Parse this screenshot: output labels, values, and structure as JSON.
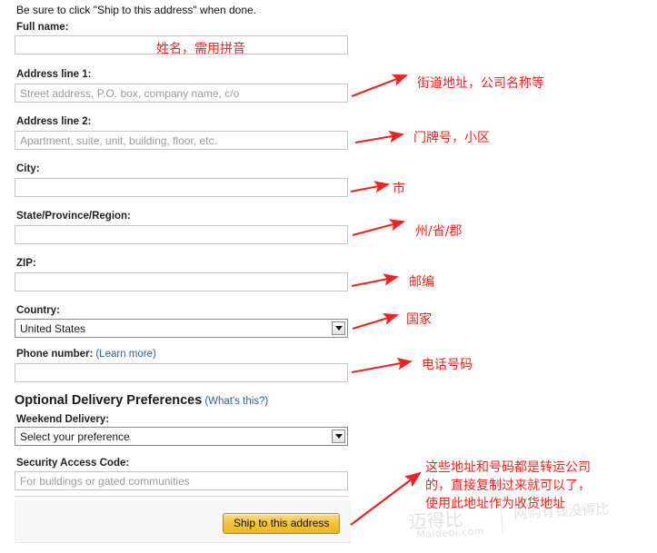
{
  "intro": {
    "text": "Be sure to click \"Ship to this address\" when done."
  },
  "form": {
    "full_name": {
      "label": "Full name:",
      "value": "",
      "placeholder": ""
    },
    "address1": {
      "label": "Address line 1:",
      "value": "",
      "placeholder": "Street address, P.O. box, company name, c/o"
    },
    "address2": {
      "label": "Address line 2:",
      "value": "",
      "placeholder": "Apartment, suite, unit, building, floor, etc."
    },
    "city": {
      "label": "City:",
      "value": "",
      "placeholder": ""
    },
    "state": {
      "label": "State/Province/Region:",
      "value": "",
      "placeholder": ""
    },
    "zip": {
      "label": "ZIP:",
      "value": "",
      "placeholder": ""
    },
    "country": {
      "label": "Country:",
      "selected": "United States"
    },
    "phone": {
      "label": "Phone number:",
      "link": "(Learn more)",
      "value": "",
      "placeholder": ""
    },
    "optional_section": {
      "heading": "Optional Delivery Preferences",
      "link": "(What's this?)"
    },
    "weekend": {
      "label": "Weekend Delivery:",
      "selected": "Select your preference"
    },
    "security_code": {
      "label": "Security Access Code:",
      "value": "",
      "placeholder": "For buildings or gated communities"
    },
    "submit": {
      "label": "Ship to this address"
    }
  },
  "annotations": {
    "full_name_note": "姓名，需用拼音",
    "address1_note": "街道地址，公司名称等",
    "address2_note": "门牌号，小区",
    "city_note": "市",
    "state_note": "州/省/郡",
    "zip_note": "邮编",
    "country_note": "国家",
    "phone_note": "电话号码",
    "bottom_note_line1": "这些地址和号码都是转运公司",
    "bottom_note_line2": "的，直接复制过来就可以了，",
    "bottom_note_line3": "使用此地址作为收货地址",
    "color": "#ee2222"
  },
  "watermark": {
    "brand_cn": "迈得比",
    "domain": "Maidebi.com",
    "tagline": "网购有钱没得比"
  },
  "colors": {
    "annotation_red": "#ee2222",
    "link_blue": "#2a6496",
    "button_gold": "#f2c33c",
    "input_border": "#c6c6c6"
  }
}
